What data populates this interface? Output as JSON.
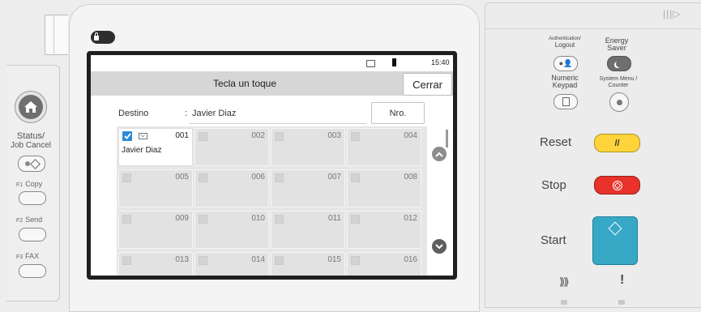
{
  "left_panel": {
    "status_label_1": "Status/",
    "status_label_2": "Job Cancel",
    "f1_key": "F1",
    "f1_label": "Copy",
    "f2_key": "F2",
    "f2_label": "Send",
    "f3_key": "F3",
    "f3_label": "FAX"
  },
  "screen": {
    "time": "15:40",
    "title": "Tecla un toque",
    "close_label": "Cerrar",
    "destination_label": "Destino",
    "destination_colon": ":",
    "destination_value": "Javier Diaz",
    "number_button": "Nro.",
    "tiles": [
      {
        "num": "001",
        "name": "Javier Diaz",
        "selected": true
      },
      {
        "num": "002",
        "name": "",
        "selected": false
      },
      {
        "num": "003",
        "name": "",
        "selected": false
      },
      {
        "num": "004",
        "name": "",
        "selected": false
      },
      {
        "num": "005",
        "name": "",
        "selected": false
      },
      {
        "num": "006",
        "name": "",
        "selected": false
      },
      {
        "num": "007",
        "name": "",
        "selected": false
      },
      {
        "num": "008",
        "name": "",
        "selected": false
      },
      {
        "num": "009",
        "name": "",
        "selected": false
      },
      {
        "num": "010",
        "name": "",
        "selected": false
      },
      {
        "num": "011",
        "name": "",
        "selected": false
      },
      {
        "num": "012",
        "name": "",
        "selected": false
      },
      {
        "num": "013",
        "name": "",
        "selected": false
      },
      {
        "num": "014",
        "name": "",
        "selected": false
      },
      {
        "num": "015",
        "name": "",
        "selected": false
      },
      {
        "num": "016",
        "name": "",
        "selected": false
      }
    ]
  },
  "right_panel": {
    "auth_label_1": "Authentication/",
    "auth_label_2": "Logout",
    "energy_label_1": "Energy",
    "energy_label_2": "Saver",
    "numeric_label_1": "Numeric",
    "numeric_label_2": "Keypad",
    "sysmenu_label_1": "System Menu /",
    "sysmenu_label_2": "Counter",
    "reset_label": "Reset",
    "stop_label": "Stop",
    "start_label": "Start"
  },
  "colors": {
    "reset": "#ffd43a",
    "stop": "#e8322a",
    "start": "#37a9c7",
    "checkbox_selected": "#2b8bd8"
  }
}
